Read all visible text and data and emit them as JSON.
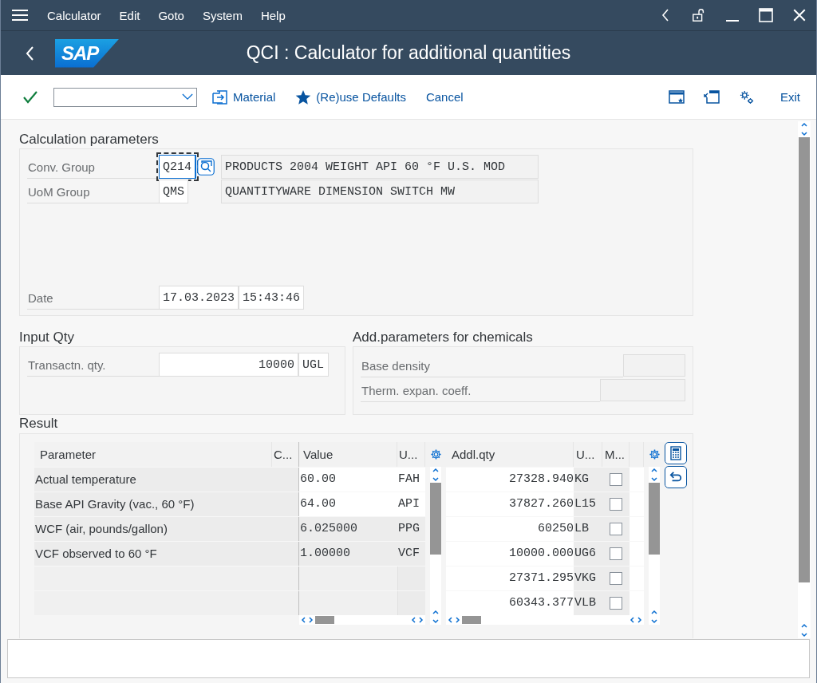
{
  "menu_bar": {
    "items": [
      "Calculator",
      "Edit",
      "Goto",
      "System",
      "Help"
    ]
  },
  "title_bar": {
    "logo": "SAP",
    "title": "QCI : Calculator for additional quantities"
  },
  "toolbar": {
    "buttons": [
      {
        "label": "Material",
        "kind": "material"
      },
      {
        "label": "(Re)use Defaults",
        "kind": "star"
      },
      {
        "label": "Cancel",
        "kind": "plain"
      }
    ],
    "exit": "Exit"
  },
  "calculation_parameters": {
    "title": "Calculation parameters",
    "rows": [
      {
        "label": "Conv. Group",
        "code": "Q214",
        "focused": true,
        "value_help": true,
        "description": "PRODUCTS 2004 WEIGHT API 60 °F U.S. MOD"
      },
      {
        "label": "UoM Group",
        "code": "QMS",
        "focused": false,
        "value_help": false,
        "description": "QUANTITYWARE DIMENSION SWITCH MW"
      }
    ],
    "date": {
      "label": "Date",
      "date": "17.03.2023",
      "time": "15:43:46"
    }
  },
  "input_qty": {
    "title": "Input Qty",
    "label": "Transactn. qty.",
    "value": "10000",
    "unit": "UGL"
  },
  "chemicals": {
    "title": "Add.parameters for chemicals",
    "rows": [
      {
        "label": "Base density",
        "kind": "short"
      },
      {
        "label": "Therm. expan. coeff.",
        "kind": "long"
      }
    ]
  },
  "result": {
    "title": "Result",
    "parameters_table": {
      "columns": [
        "Parameter",
        "C...",
        "Value",
        "U..."
      ],
      "rows": [
        {
          "parameter": "Actual temperature",
          "value": "60.00",
          "unit": "FAH",
          "editable": true
        },
        {
          "parameter": "Base API Gravity (vac., 60 °F)",
          "value": "64.00",
          "unit": "API",
          "editable": true
        },
        {
          "parameter": "WCF (air, pounds/gallon)",
          "value": "6.025000",
          "unit": "PPG",
          "editable": false
        },
        {
          "parameter": "VCF observed to 60 °F",
          "value": "1.00000",
          "unit": "VCF",
          "editable": false
        }
      ]
    },
    "quantities_table": {
      "columns": [
        "Addl.qty",
        "U...",
        "M..."
      ],
      "rows": [
        {
          "qty": "27328.940",
          "unit": "KG",
          "checked": false
        },
        {
          "qty": "37827.260",
          "unit": "L15",
          "checked": false
        },
        {
          "qty": "60250",
          "unit": "LB",
          "checked": false
        },
        {
          "qty": "10000.000",
          "unit": "UG6",
          "checked": false
        },
        {
          "qty": "27371.295",
          "unit": "VKG",
          "checked": false
        },
        {
          "qty": "60343.377",
          "unit": "VLB",
          "checked": false
        }
      ]
    }
  }
}
